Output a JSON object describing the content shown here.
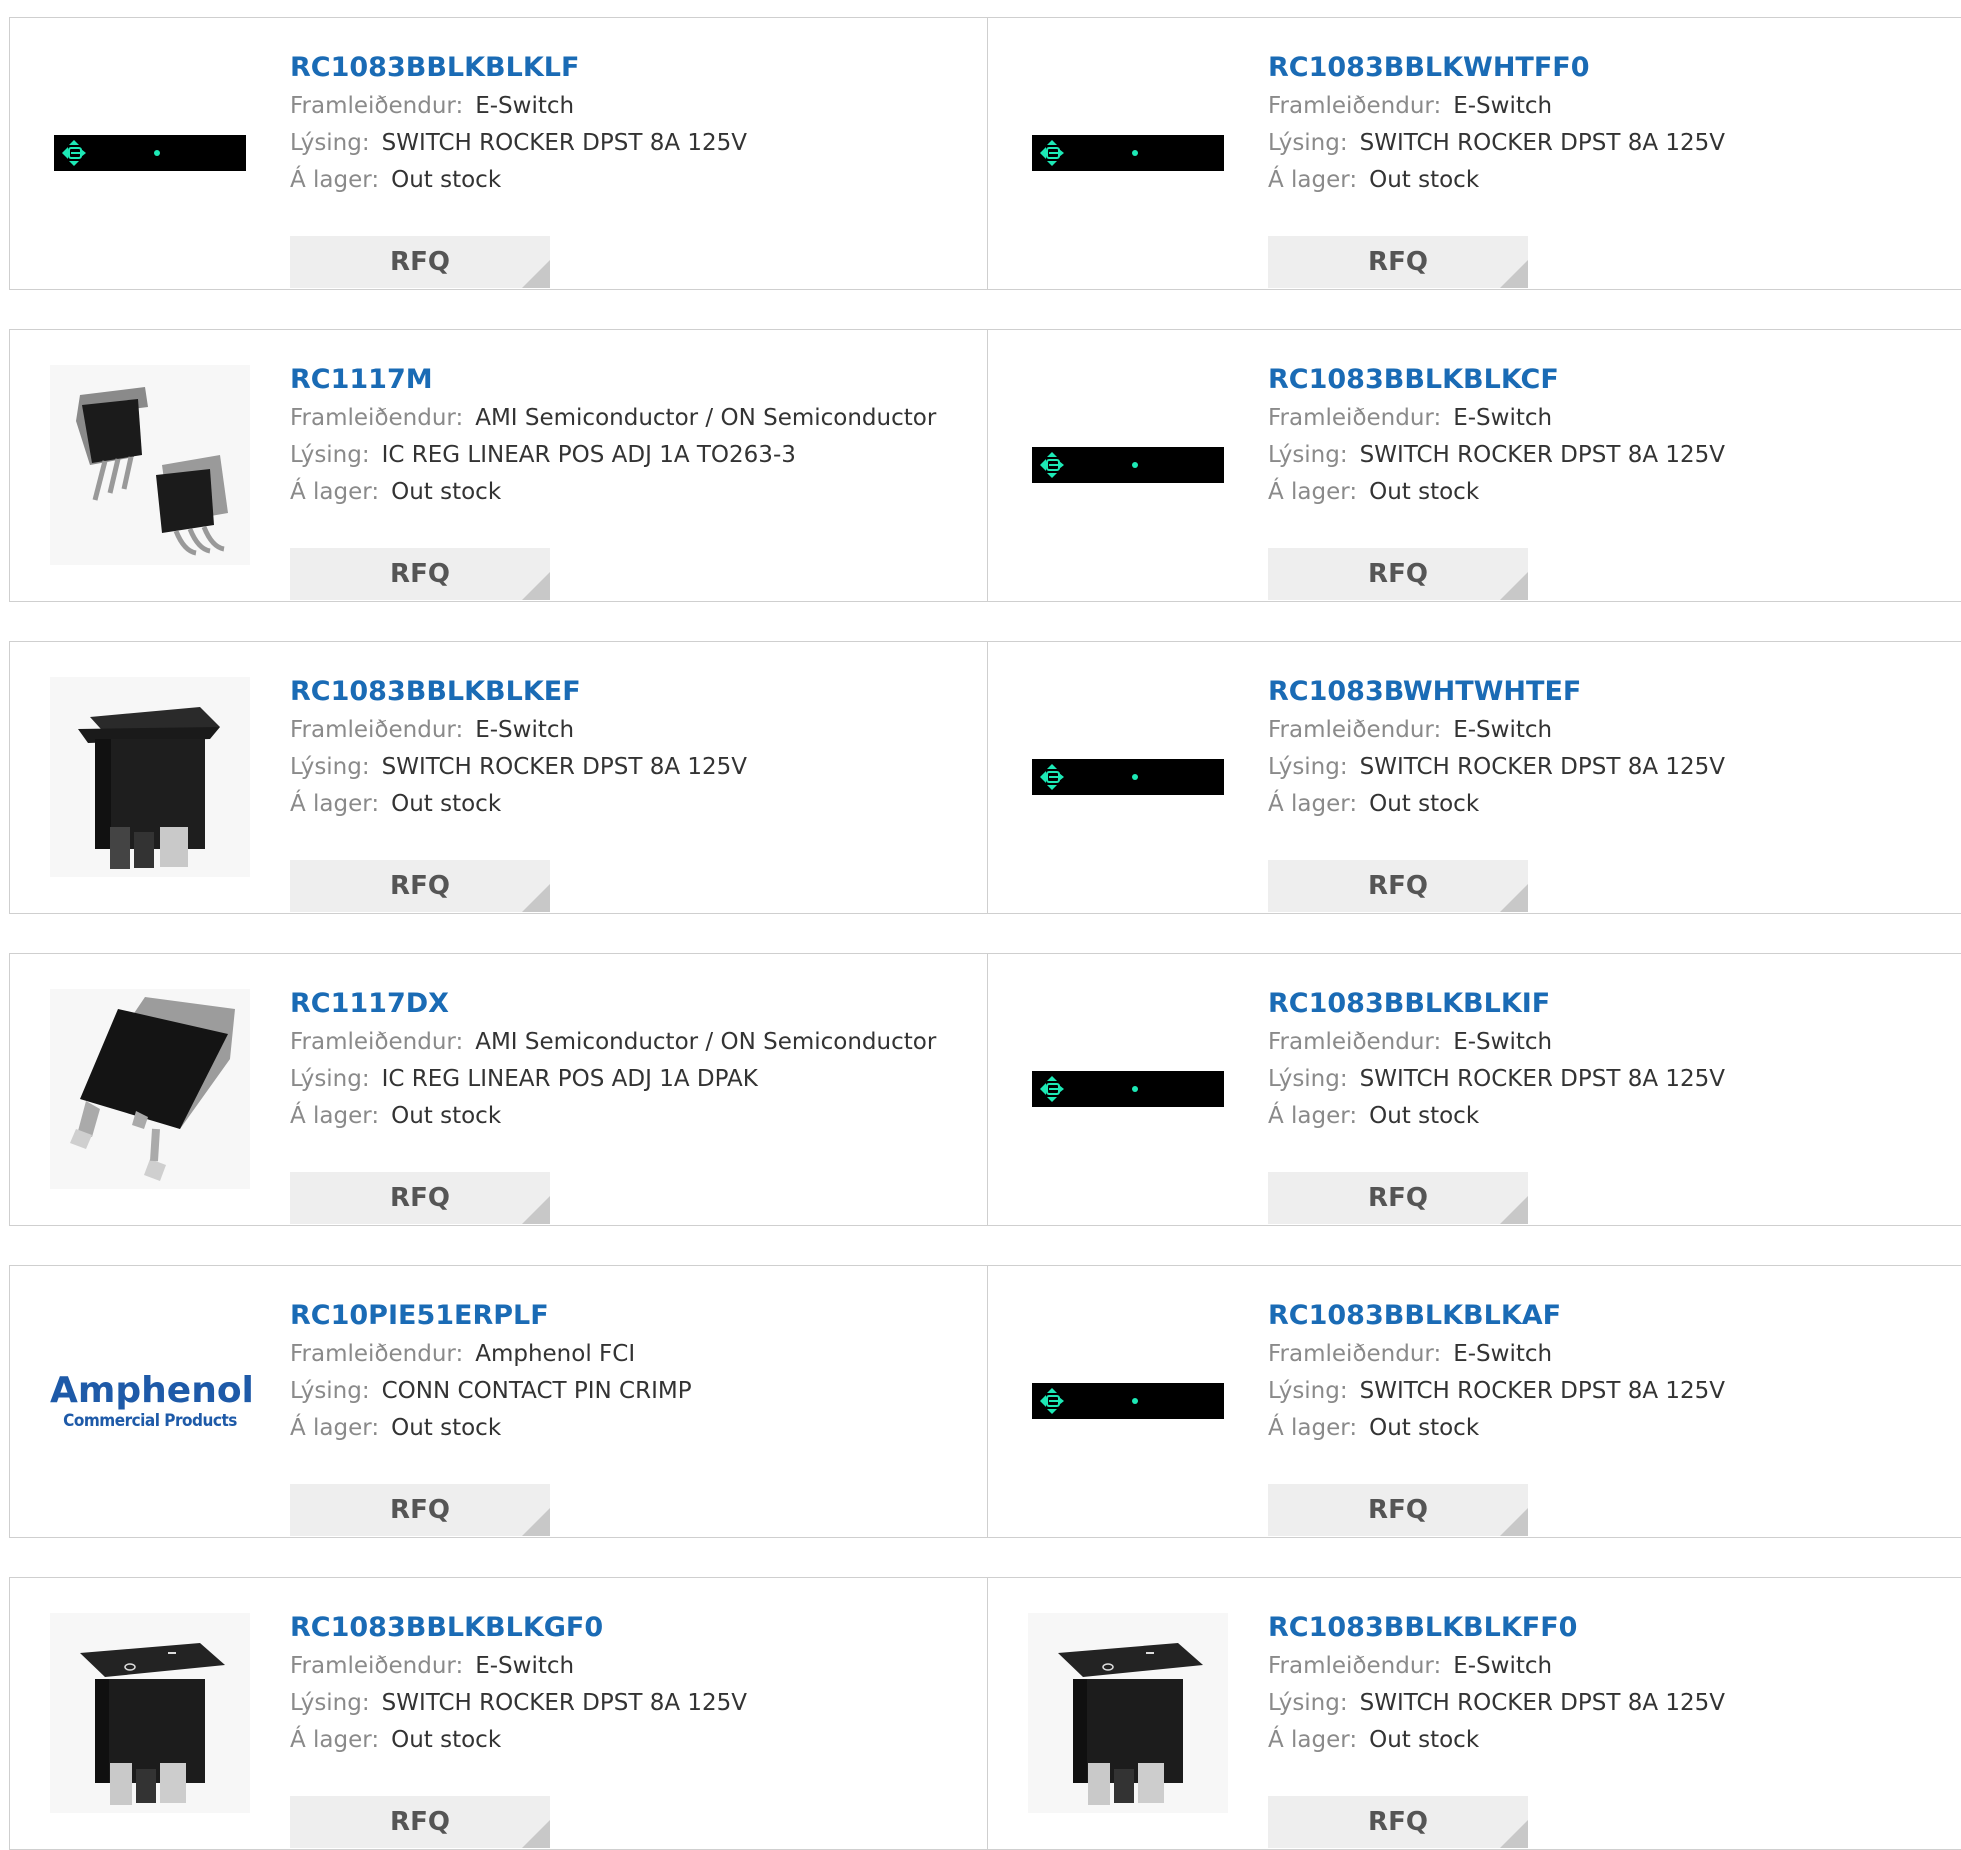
{
  "labels": {
    "manufacturer": "Framleiðendur:",
    "description": "Lýsing:",
    "stock": "Á lager:",
    "rfq": "RFQ"
  },
  "colors": {
    "link": "#1a6bb5",
    "label": "#8a8a8a",
    "value": "#333333",
    "button_bg": "#eeeeee",
    "accent_green": "#1de9b6"
  },
  "rows": [
    {
      "left": {
        "part": "RC1083BBLKBLKLF",
        "manufacturer": "E-Switch",
        "description": "SWITCH ROCKER DPST 8A 125V",
        "stock": "Out stock",
        "image": "eswitch-strip"
      },
      "right": {
        "part": "RC1083BBLKWHTFF0",
        "manufacturer": "E-Switch",
        "description": "SWITCH ROCKER DPST 8A 125V",
        "stock": "Out stock",
        "image": "eswitch-strip"
      }
    },
    {
      "left": {
        "part": "RC1117M",
        "manufacturer": "AMI Semiconductor / ON Semiconductor",
        "description": "IC REG LINEAR POS ADJ 1A TO263-3",
        "stock": "Out stock",
        "image": "to263-package"
      },
      "right": {
        "part": "RC1083BBLKBLKCF",
        "manufacturer": "E-Switch",
        "description": "SWITCH ROCKER DPST 8A 125V",
        "stock": "Out stock",
        "image": "eswitch-strip"
      }
    },
    {
      "left": {
        "part": "RC1083BBLKBLKEF",
        "manufacturer": "E-Switch",
        "description": "SWITCH ROCKER DPST 8A 125V",
        "stock": "Out stock",
        "image": "rocker-switch"
      },
      "right": {
        "part": "RC1083BWHTWHTEF",
        "manufacturer": "E-Switch",
        "description": "SWITCH ROCKER DPST 8A 125V",
        "stock": "Out stock",
        "image": "eswitch-strip"
      }
    },
    {
      "left": {
        "part": "RC1117DX",
        "manufacturer": "AMI Semiconductor / ON Semiconductor",
        "description": "IC REG LINEAR POS ADJ 1A DPAK",
        "stock": "Out stock",
        "image": "dpak-package"
      },
      "right": {
        "part": "RC1083BBLKBLKIF",
        "manufacturer": "E-Switch",
        "description": "SWITCH ROCKER DPST 8A 125V",
        "stock": "Out stock",
        "image": "eswitch-strip"
      }
    },
    {
      "left": {
        "part": "RC10PIE51ERPLF",
        "manufacturer": "Amphenol FCI",
        "description": "CONN CONTACT PIN CRIMP",
        "stock": "Out stock",
        "image": "amphenol-logo",
        "logo_line1": "Amphenol",
        "logo_line2": "Commercial Products"
      },
      "right": {
        "part": "RC1083BBLKBLKAF",
        "manufacturer": "E-Switch",
        "description": "SWITCH ROCKER DPST 8A 125V",
        "stock": "Out stock",
        "image": "eswitch-strip"
      }
    },
    {
      "left": {
        "part": "RC1083BBLKBLKGF0",
        "manufacturer": "E-Switch",
        "description": "SWITCH ROCKER DPST 8A 125V",
        "stock": "Out stock",
        "image": "rocker-switch-io"
      },
      "right": {
        "part": "RC1083BBLKBLKFF0",
        "manufacturer": "E-Switch",
        "description": "SWITCH ROCKER DPST 8A 125V",
        "stock": "Out stock",
        "image": "rocker-switch-io"
      }
    }
  ]
}
